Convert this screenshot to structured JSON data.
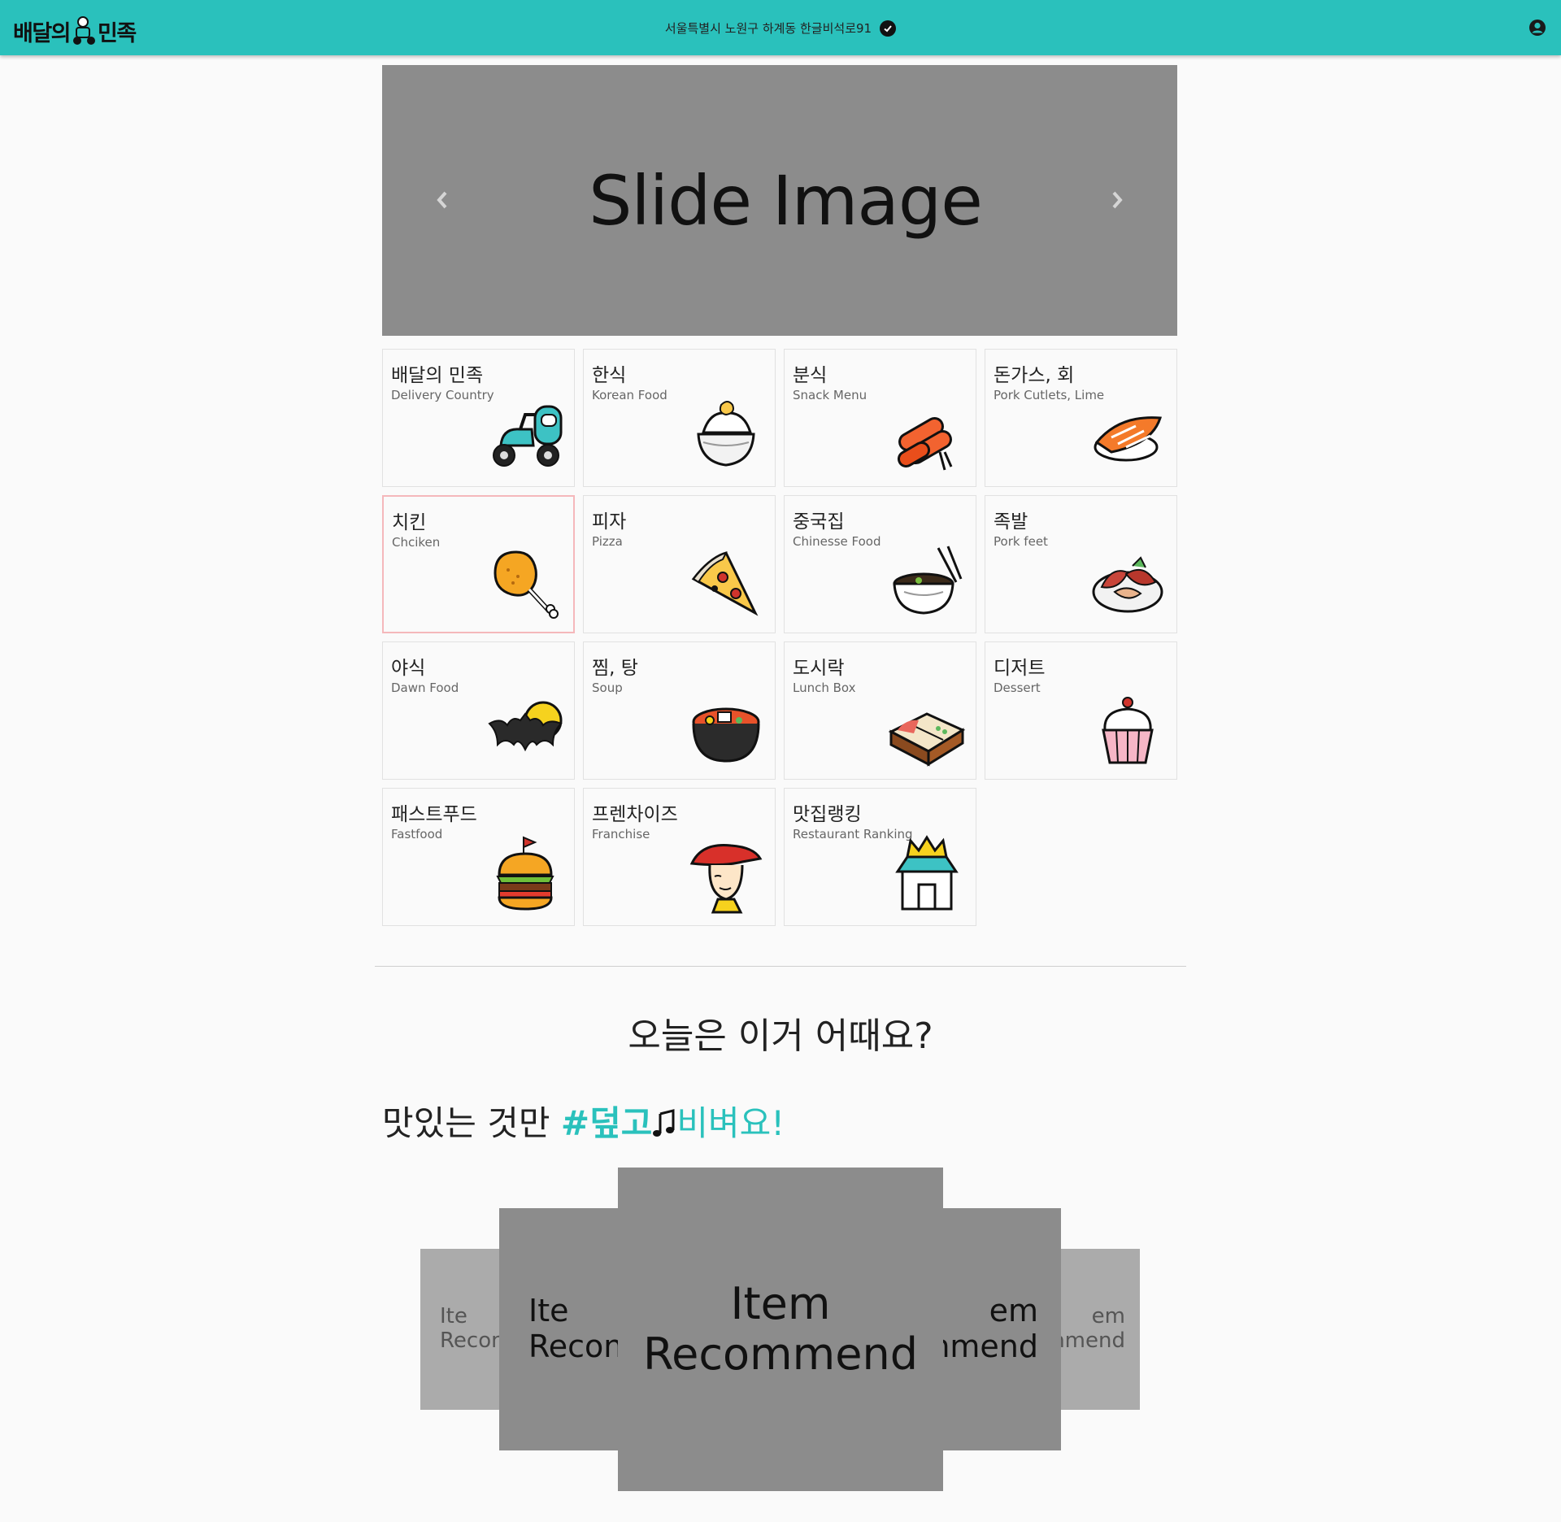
{
  "header": {
    "logo": {
      "left": "배달의",
      "mid": "",
      "right": "민족"
    },
    "address": "서울특별시 노원구 하계동 한글비석로91",
    "icons": {
      "verified": "check-circle-icon",
      "account": "user-circle-icon"
    },
    "colors": {
      "brand": "#2ac1bc"
    }
  },
  "slider": {
    "label": "Slide Image",
    "prev_icon": "chevron-left-icon",
    "next_icon": "chevron-right-icon"
  },
  "categories": [
    {
      "ko": "배달의 민족",
      "en": "Delivery Country",
      "icon": "scooter-icon"
    },
    {
      "ko": "한식",
      "en": "Korean Food",
      "icon": "rice-bowl-icon"
    },
    {
      "ko": "분식",
      "en": "Snack Menu",
      "icon": "gimbap-icon"
    },
    {
      "ko": "돈가스, 회",
      "en": "Pork Cutlets, Lime",
      "icon": "sushi-icon"
    },
    {
      "ko": "치킨",
      "en": "Chciken",
      "icon": "chicken-leg-icon"
    },
    {
      "ko": "피자",
      "en": "Pizza",
      "icon": "pizza-slice-icon"
    },
    {
      "ko": "중국집",
      "en": "Chinesse Food",
      "icon": "noodle-bowl-icon"
    },
    {
      "ko": "족발",
      "en": "Pork feet",
      "icon": "pork-feet-icon"
    },
    {
      "ko": "야식",
      "en": "Dawn Food",
      "icon": "bat-moon-icon"
    },
    {
      "ko": "찜, 탕",
      "en": "Soup",
      "icon": "stew-pot-icon"
    },
    {
      "ko": "도시락",
      "en": "Lunch Box",
      "icon": "lunch-box-icon"
    },
    {
      "ko": "디저트",
      "en": "Dessert",
      "icon": "cupcake-icon"
    },
    {
      "ko": "패스트푸드",
      "en": "Fastfood",
      "icon": "burger-icon"
    },
    {
      "ko": "프렌차이즈",
      "en": "Franchise",
      "icon": "chef-hat-icon"
    },
    {
      "ko": "맛집랭킹",
      "en": "Restaurant Ranking",
      "icon": "crown-store-icon"
    }
  ],
  "active_category": "치킨",
  "today": {
    "title": "오늘은 이거 어때요?"
  },
  "tagline": {
    "prefix": "맛있는 것만 ",
    "hash": "#덮고",
    "hash2": "비벼요!",
    "note_icon": "music-note-icon"
  },
  "recommend": {
    "far_left": {
      "line1": "Ite",
      "line2": "Recon"
    },
    "near_left": {
      "line1": "Ite",
      "line2": "Recon"
    },
    "center": {
      "line1": "Item",
      "line2": "Recommend"
    },
    "near_right": {
      "line1": "em",
      "line2": "nmend"
    },
    "far_right": {
      "line1": "em",
      "line2": "nmend"
    }
  }
}
